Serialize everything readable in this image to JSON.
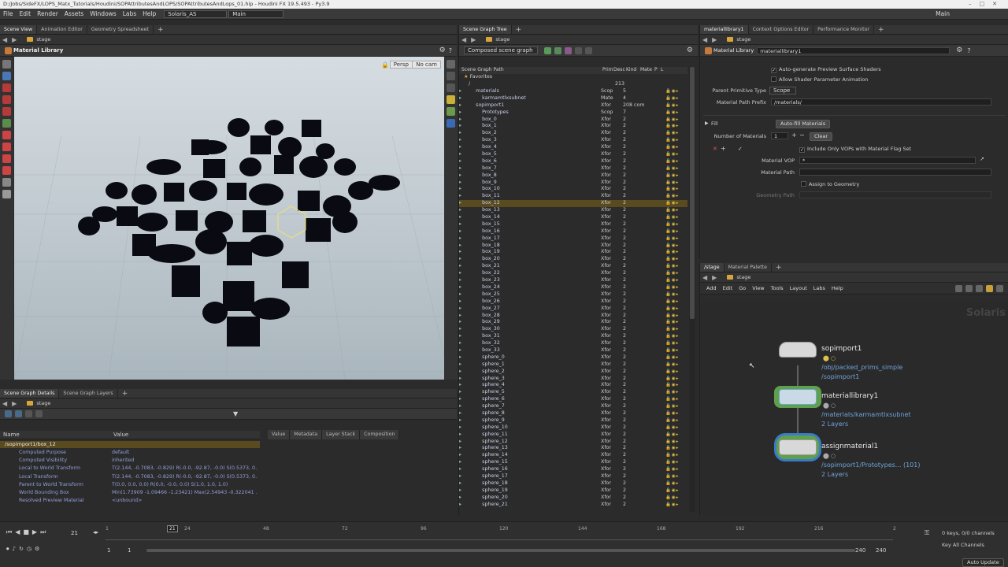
{
  "titlebar": {
    "path": "D:/Jobs/SideFX/LOPS_Matx_Tutorials/Houdini/SOPAttributesAndLOPS/SOPAttributesAndLops_01.hip - Houdini FX 19.5.493 - Py3.9"
  },
  "menubar": {
    "items": [
      "File",
      "Edit",
      "Render",
      "Assets",
      "Windows",
      "Labs",
      "Help"
    ],
    "desktop": "Solaris_AS",
    "context": "Main",
    "right_context": "Main"
  },
  "scene_view": {
    "tabs": [
      "Scene View",
      "Animation Editor",
      "Geometry Spreadsheet"
    ],
    "path": "stage",
    "tool_name": "Material Library",
    "persp": "Persp",
    "cam": "No cam"
  },
  "scene_graph_tree": {
    "tab": "Scene Graph Tree",
    "path": "stage",
    "mode": "Composed scene graph",
    "headers": {
      "path": "Scene Graph Path",
      "prim": "Prim",
      "desc": "Desc",
      "kind": "Kind",
      "mate": "Mate",
      "p": "P",
      "l": "L"
    },
    "favorites": "Favorites",
    "root_count": "213",
    "rows": [
      {
        "name": "materials",
        "kind": "Scop",
        "desc": "5",
        "indent": 1
      },
      {
        "name": "karmamtlxsubnet",
        "kind": "Mate",
        "desc": "4",
        "indent": 2
      },
      {
        "name": "sopimport1",
        "kind": "Xfor",
        "desc": "208 com",
        "indent": 1
      },
      {
        "name": "Prototypes",
        "kind": "Scop",
        "desc": "7",
        "indent": 2
      },
      {
        "name": "box_0",
        "kind": "Xfor",
        "desc": "2",
        "indent": 2
      },
      {
        "name": "box_1",
        "kind": "Xfor",
        "desc": "2",
        "indent": 2
      },
      {
        "name": "box_2",
        "kind": "Xfor",
        "desc": "2",
        "indent": 2
      },
      {
        "name": "box_3",
        "kind": "Xfor",
        "desc": "2",
        "indent": 2
      },
      {
        "name": "box_4",
        "kind": "Xfor",
        "desc": "2",
        "indent": 2
      },
      {
        "name": "box_5",
        "kind": "Xfor",
        "desc": "2",
        "indent": 2
      },
      {
        "name": "box_6",
        "kind": "Xfor",
        "desc": "2",
        "indent": 2
      },
      {
        "name": "box_7",
        "kind": "Xfor",
        "desc": "2",
        "indent": 2
      },
      {
        "name": "box_8",
        "kind": "Xfor",
        "desc": "2",
        "indent": 2
      },
      {
        "name": "box_9",
        "kind": "Xfor",
        "desc": "2",
        "indent": 2
      },
      {
        "name": "box_10",
        "kind": "Xfor",
        "desc": "2",
        "indent": 2
      },
      {
        "name": "box_11",
        "kind": "Xfor",
        "desc": "2",
        "indent": 2
      },
      {
        "name": "box_12",
        "kind": "Xfor",
        "desc": "2",
        "indent": 2,
        "selected": true
      },
      {
        "name": "box_13",
        "kind": "Xfor",
        "desc": "2",
        "indent": 2
      },
      {
        "name": "box_14",
        "kind": "Xfor",
        "desc": "2",
        "indent": 2
      },
      {
        "name": "box_15",
        "kind": "Xfor",
        "desc": "2",
        "indent": 2
      },
      {
        "name": "box_16",
        "kind": "Xfor",
        "desc": "2",
        "indent": 2
      },
      {
        "name": "box_17",
        "kind": "Xfor",
        "desc": "2",
        "indent": 2
      },
      {
        "name": "box_18",
        "kind": "Xfor",
        "desc": "2",
        "indent": 2
      },
      {
        "name": "box_19",
        "kind": "Xfor",
        "desc": "2",
        "indent": 2
      },
      {
        "name": "box_20",
        "kind": "Xfor",
        "desc": "2",
        "indent": 2
      },
      {
        "name": "box_21",
        "kind": "Xfor",
        "desc": "2",
        "indent": 2
      },
      {
        "name": "box_22",
        "kind": "Xfor",
        "desc": "2",
        "indent": 2
      },
      {
        "name": "box_23",
        "kind": "Xfor",
        "desc": "2",
        "indent": 2
      },
      {
        "name": "box_24",
        "kind": "Xfor",
        "desc": "2",
        "indent": 2
      },
      {
        "name": "box_25",
        "kind": "Xfor",
        "desc": "2",
        "indent": 2
      },
      {
        "name": "box_26",
        "kind": "Xfor",
        "desc": "2",
        "indent": 2
      },
      {
        "name": "box_27",
        "kind": "Xfor",
        "desc": "2",
        "indent": 2
      },
      {
        "name": "box_28",
        "kind": "Xfor",
        "desc": "2",
        "indent": 2
      },
      {
        "name": "box_29",
        "kind": "Xfor",
        "desc": "2",
        "indent": 2
      },
      {
        "name": "box_30",
        "kind": "Xfor",
        "desc": "2",
        "indent": 2
      },
      {
        "name": "box_31",
        "kind": "Xfor",
        "desc": "2",
        "indent": 2
      },
      {
        "name": "box_32",
        "kind": "Xfor",
        "desc": "2",
        "indent": 2
      },
      {
        "name": "box_33",
        "kind": "Xfor",
        "desc": "2",
        "indent": 2
      },
      {
        "name": "sphere_0",
        "kind": "Xfor",
        "desc": "2",
        "indent": 2
      },
      {
        "name": "sphere_1",
        "kind": "Xfor",
        "desc": "2",
        "indent": 2
      },
      {
        "name": "sphere_2",
        "kind": "Xfor",
        "desc": "2",
        "indent": 2
      },
      {
        "name": "sphere_3",
        "kind": "Xfor",
        "desc": "2",
        "indent": 2
      },
      {
        "name": "sphere_4",
        "kind": "Xfor",
        "desc": "2",
        "indent": 2
      },
      {
        "name": "sphere_5",
        "kind": "Xfor",
        "desc": "2",
        "indent": 2
      },
      {
        "name": "sphere_6",
        "kind": "Xfor",
        "desc": "2",
        "indent": 2
      },
      {
        "name": "sphere_7",
        "kind": "Xfor",
        "desc": "2",
        "indent": 2
      },
      {
        "name": "sphere_8",
        "kind": "Xfor",
        "desc": "2",
        "indent": 2
      },
      {
        "name": "sphere_9",
        "kind": "Xfor",
        "desc": "2",
        "indent": 2
      },
      {
        "name": "sphere_10",
        "kind": "Xfor",
        "desc": "2",
        "indent": 2
      },
      {
        "name": "sphere_11",
        "kind": "Xfor",
        "desc": "2",
        "indent": 2
      },
      {
        "name": "sphere_12",
        "kind": "Xfor",
        "desc": "2",
        "indent": 2
      },
      {
        "name": "sphere_13",
        "kind": "Xfor",
        "desc": "2",
        "indent": 2
      },
      {
        "name": "sphere_14",
        "kind": "Xfor",
        "desc": "2",
        "indent": 2
      },
      {
        "name": "sphere_15",
        "kind": "Xfor",
        "desc": "2",
        "indent": 2
      },
      {
        "name": "sphere_16",
        "kind": "Xfor",
        "desc": "2",
        "indent": 2
      },
      {
        "name": "sphere_17",
        "kind": "Xfor",
        "desc": "2",
        "indent": 2
      },
      {
        "name": "sphere_18",
        "kind": "Xfor",
        "desc": "2",
        "indent": 2
      },
      {
        "name": "sphere_19",
        "kind": "Xfor",
        "desc": "2",
        "indent": 2
      },
      {
        "name": "sphere_20",
        "kind": "Xfor",
        "desc": "2",
        "indent": 2
      },
      {
        "name": "sphere_21",
        "kind": "Xfor",
        "desc": "2",
        "indent": 2
      }
    ]
  },
  "details": {
    "tabs": [
      "Scene Graph Details",
      "Scene Graph Layers"
    ],
    "path": "stage",
    "headers": {
      "name": "Name",
      "value": "Value"
    },
    "prim_path": "/sopimport1/box_12",
    "props": [
      {
        "name": "Computed Purpose",
        "value": "default"
      },
      {
        "name": "Computed Visibility",
        "value": "inherited"
      },
      {
        "name": "Local to World Transform",
        "value": "T(2.144, -0.7083, -0.829) R(-0.0, -92.87, -0.0) S(0.5373, 0...."
      },
      {
        "name": "Local Transform",
        "value": "T(2.144, -0.7083, -0.829) R(-0.0, -92.87, -0.0) S(0.5373, 0...."
      },
      {
        "name": "Parent to World Transform",
        "value": "T(0.0, 0.0, 0.0) R(0.0, -0.0, 0.0) S(1.0, 1.0, 1.0)"
      },
      {
        "name": "World Bounding Box",
        "value": "Min(1.73909 -1.09466 -1.23421) Max(2.54943 -0.322041 ..."
      },
      {
        "name": "Resolved Preview Material",
        "value": "<unbound>"
      }
    ],
    "side_tabs": [
      "Value",
      "Metadata",
      "Layer Stack",
      "Composition"
    ]
  },
  "param_editor": {
    "tabs": [
      "materiallibrary1",
      "Context Options Editor",
      "Performance Monitor"
    ],
    "path": "stage",
    "node_type": "Material Library",
    "node_name": "materiallibrary1",
    "auto_preview": "Auto-generate Preview Surface Shaders",
    "allow_anim": "Allow Shader Parameter Animation",
    "parent_prim_label": "Parent Primitive Type",
    "parent_prim_value": "Scope",
    "mat_prefix_label": "Material Path Prefix",
    "mat_prefix_value": "/materials/",
    "fill_label": "Fill",
    "autofill_button": "Auto-fill Materials",
    "num_materials_label": "Number of Materials",
    "num_materials_value": "1",
    "clear_button": "Clear",
    "include_only": "Include Only VOPs with Material Flag Set",
    "material_vop_label": "Material VOP",
    "material_vop_value": "*",
    "material_path_label": "Material Path",
    "material_path_value": "",
    "assign_label": "Assign to Geometry",
    "geometry_path_label": "Geometry Path"
  },
  "network": {
    "tabs": [
      "/stage",
      "Material Palette"
    ],
    "path": "stage",
    "menu": [
      "Add",
      "Edit",
      "Go",
      "View",
      "Tools",
      "Layout",
      "Labs",
      "Help"
    ],
    "watermark": "Solaris",
    "nodes": [
      {
        "name": "sopimport1",
        "sub1": "/obj/packed_prims_simple",
        "sub2": "/sopimport1"
      },
      {
        "name": "materiallibrary1",
        "sub1": "/materials/karmamtlxsubnet",
        "sub2": "2 Layers"
      },
      {
        "name": "assignmaterial1",
        "sub1": "/sopimport1/Prototypes... (101)",
        "sub2": "2 Layers"
      }
    ]
  },
  "timeline": {
    "frame": "21",
    "marker": "21",
    "ticks": [
      "1",
      "24",
      "48",
      "72",
      "96",
      "120",
      "144",
      "168",
      "192",
      "216",
      "2"
    ],
    "start": "1",
    "start2": "1",
    "end": "240",
    "end2": "240",
    "keys": "0 keys, 0/0 channels",
    "key_all": "Key All Channels",
    "auto_update": "Auto Update"
  },
  "colors": {
    "accent": "#d9a43b",
    "node_blue": "#6fa3d8",
    "select": "#5a4a1f"
  }
}
